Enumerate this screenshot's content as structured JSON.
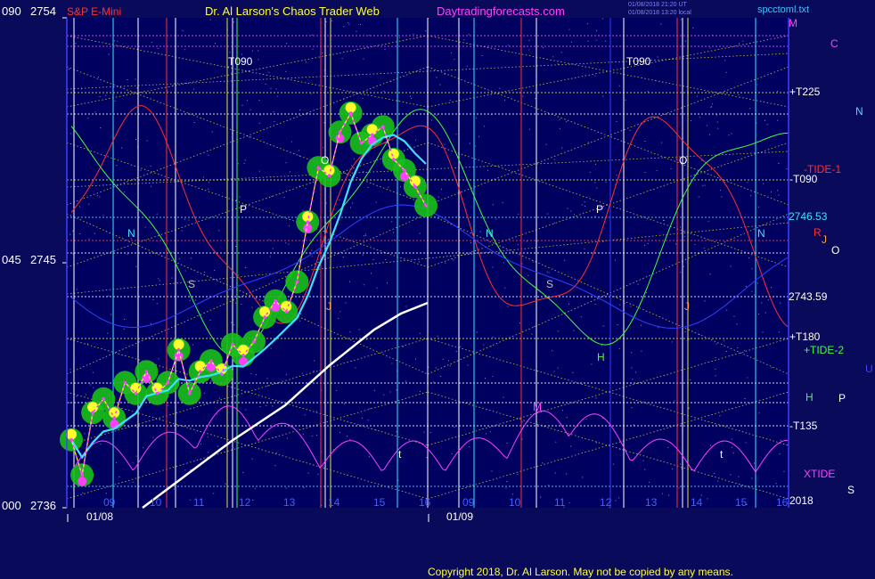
{
  "header": {
    "symbol": "S&P E-Mini",
    "title": "Dr. Al Larson's Chaos Trader Web",
    "site": "Daytradingforecasts.com",
    "stamp1": "01/08/2018 21:20 UT",
    "stamp2": "01/08/2018 13:20 local",
    "file": "spcctoml.txt",
    "colors": {
      "symbol": "#ff3030",
      "title": "#ffff40",
      "site": "#ff40ff",
      "stamp": "#8080ff",
      "file": "#40c0ff"
    }
  },
  "footer": {
    "copyright": "Copyright 2018, Dr. Al Larson. May not be copied by any means."
  },
  "left_axis": [
    {
      "deg": "090",
      "price": "2754"
    },
    {
      "deg": "045",
      "price": "2745"
    },
    {
      "deg": "000",
      "price": "2736"
    }
  ],
  "right_labels": [
    {
      "text": "M",
      "color": "#ff40ff"
    },
    {
      "text": "C",
      "color": "#ff40ff"
    },
    {
      "text": "+T225",
      "color": "#ffffff"
    },
    {
      "text": "N",
      "color": "#40e0ff"
    },
    {
      "text": "-TIDE-1",
      "color": "#ff3030"
    },
    {
      "text": "-T090",
      "color": "#ffffff"
    },
    {
      "text": "2746.53",
      "color": "#40e0ff"
    },
    {
      "text": "R",
      "color": "#ff3030"
    },
    {
      "text": "J",
      "color": "#ffa040"
    },
    {
      "text": "O",
      "color": "#ffffff"
    },
    {
      "text": "2743.59",
      "color": "#ffffff"
    },
    {
      "text": "+T180",
      "color": "#ffffff"
    },
    {
      "text": "+TIDE-2",
      "color": "#40ff40"
    },
    {
      "text": "U",
      "color": "#4040ff"
    },
    {
      "text": "H",
      "color": "#40ff40"
    },
    {
      "text": "P",
      "color": "#ffffff"
    },
    {
      "text": "-T135",
      "color": "#ffffff"
    },
    {
      "text": "XTIDE",
      "color": "#ff40ff"
    },
    {
      "text": "S",
      "color": "#ffffff"
    },
    {
      "text": "2018",
      "color": "#ffffff"
    }
  ],
  "planet_labels": [
    {
      "text": "T090",
      "color": "#ffffff"
    },
    {
      "text": "T090",
      "color": "#ffffff"
    },
    {
      "text": "O",
      "color": "#ffffff"
    },
    {
      "text": "O",
      "color": "#ffffff"
    },
    {
      "text": "P",
      "color": "#ffffff"
    },
    {
      "text": "P",
      "color": "#ffffff"
    },
    {
      "text": "N",
      "color": "#40e0ff"
    },
    {
      "text": "N",
      "color": "#40e0ff"
    },
    {
      "text": "N",
      "color": "#40e0ff"
    },
    {
      "text": "S",
      "color": "#c0c0c0"
    },
    {
      "text": "S",
      "color": "#c0c0c0"
    },
    {
      "text": "J",
      "color": "#ffa040"
    },
    {
      "text": "J",
      "color": "#ffa040"
    },
    {
      "text": "H",
      "color": "#40ff40"
    },
    {
      "text": "M",
      "color": "#ff40ff"
    },
    {
      "text": "t",
      "color": "#ffffff"
    },
    {
      "text": "t",
      "color": "#ffffff"
    }
  ],
  "chart_data": {
    "type": "line",
    "title": "S&P E-Mini",
    "ylim": [
      2736,
      2754
    ],
    "y_ticks": [
      2736,
      2745,
      2754
    ],
    "y_ticks_degrees": [
      "000",
      "045",
      "090"
    ],
    "x_ticks_day1": [
      "09",
      "10",
      "11",
      "12",
      "13",
      "14",
      "15",
      "16"
    ],
    "x_ticks_day2": [
      "09",
      "10",
      "11",
      "12",
      "13",
      "14",
      "15",
      "16"
    ],
    "date_labels": [
      "01/08",
      "01/09"
    ],
    "price_levels": {
      "last": 2746.53,
      "other": 2743.59
    },
    "series": [
      {
        "name": "price",
        "color": "#ff40ff",
        "values": [
          2738.5,
          2737.2,
          2739.5,
          2740.0,
          2739.3,
          2740.6,
          2740.2,
          2741.0,
          2740.2,
          2740.6,
          2741.8,
          2740.2,
          2741.0,
          2741.4,
          2740.9,
          2742.0,
          2741.6,
          2742.1,
          2743.0,
          2743.6,
          2743.2,
          2744.3,
          2746.5,
          2748.5,
          2748.2,
          2749.8,
          2750.5,
          2749.4,
          2749.7,
          2750.0,
          2748.8,
          2748.4,
          2747.8,
          2747.1
        ]
      },
      {
        "name": "TIDE-1",
        "color": "#ff3030"
      },
      {
        "name": "TIDE-2",
        "color": "#40ff40"
      },
      {
        "name": "XTIDE",
        "color": "#ff40ff"
      }
    ],
    "colors": {
      "price": "#ff40ff",
      "glow_green": "#18c018",
      "glow_yellow": "#ffff30",
      "average": "#40e0ff",
      "long_average": "#ffffff",
      "tide1": "#ff3030",
      "tide2": "#40ff40",
      "xtide": "#ff40ff",
      "blue": "#3040ff",
      "grid": "#c0c0ff"
    }
  }
}
